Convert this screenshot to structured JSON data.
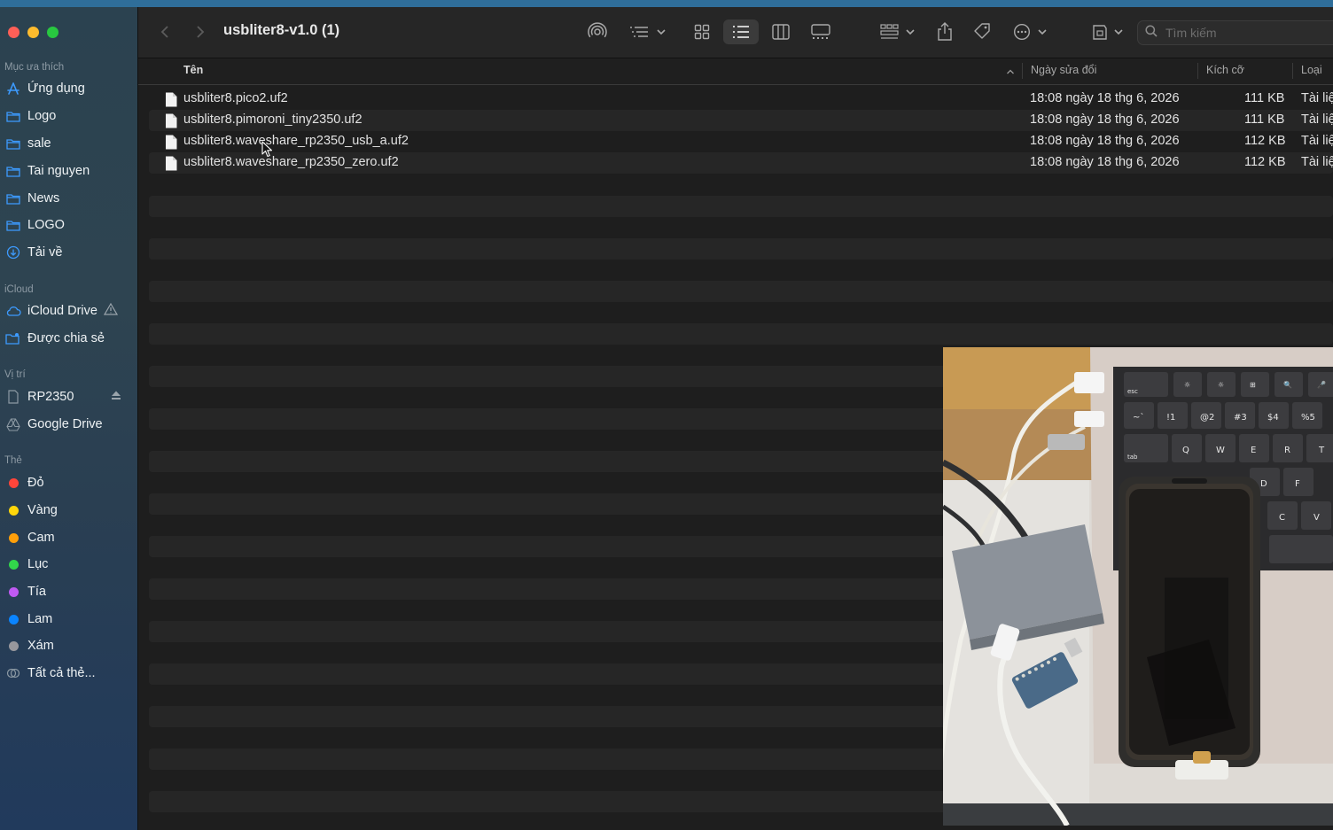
{
  "window": {
    "title": "usbliter8-v1.0 (1)"
  },
  "search": {
    "placeholder": "Tìm kiếm"
  },
  "sidebar": {
    "favorites": {
      "heading": "Mục ưa thích",
      "items": [
        {
          "label": "Ứng dụng",
          "icon": "apps-icon"
        },
        {
          "label": "Logo",
          "icon": "folder-icon"
        },
        {
          "label": "sale",
          "icon": "folder-icon"
        },
        {
          "label": "Tai nguyen",
          "icon": "folder-icon"
        },
        {
          "label": "News",
          "icon": "folder-icon"
        },
        {
          "label": "LOGO",
          "icon": "folder-icon"
        },
        {
          "label": "Tải về",
          "icon": "download-icon"
        }
      ]
    },
    "icloud": {
      "heading": "iCloud",
      "items": [
        {
          "label": "iCloud Drive",
          "icon": "cloud-icon"
        },
        {
          "label": "Được chia sẻ",
          "icon": "shared-folder-icon"
        }
      ]
    },
    "locations": {
      "heading": "Vị trí",
      "items": [
        {
          "label": "RP2350",
          "icon": "drive-icon"
        },
        {
          "label": "Google Drive",
          "icon": "google-drive-icon"
        }
      ]
    },
    "tags": {
      "heading": "Thẻ",
      "items": [
        {
          "label": "Đỏ",
          "color": "#ff453a"
        },
        {
          "label": "Vàng",
          "color": "#ffd60a"
        },
        {
          "label": "Cam",
          "color": "#ff9f0a"
        },
        {
          "label": "Lục",
          "color": "#32d74b"
        },
        {
          "label": "Tía",
          "color": "#bf5af2"
        },
        {
          "label": "Lam",
          "color": "#0a84ff"
        },
        {
          "label": "Xám",
          "color": "#98989d"
        },
        {
          "label": "Tất cả thẻ...",
          "color": ""
        }
      ]
    }
  },
  "columns": {
    "name": "Tên",
    "date": "Ngày sửa đổi",
    "size": "Kích cỡ",
    "kind": "Loại"
  },
  "files": [
    {
      "name": "usbliter8.pico2.uf2",
      "date": "18:08 ngày 18 thg 6, 2026",
      "size": "111 KB",
      "kind": "Tài liệ"
    },
    {
      "name": "usbliter8.pimoroni_tiny2350.uf2",
      "date": "18:08 ngày 18 thg 6, 2026",
      "size": "111 KB",
      "kind": "Tài liệ"
    },
    {
      "name": "usbliter8.waveshare_rp2350_usb_a.uf2",
      "date": "18:08 ngày 18 thg 6, 2026",
      "size": "112 KB",
      "kind": "Tài liệ"
    },
    {
      "name": "usbliter8.waveshare_rp2350_zero.uf2",
      "date": "18:08 ngày 18 thg 6, 2026",
      "size": "112 KB",
      "kind": "Tài liệ"
    }
  ],
  "keyboard": {
    "row1": [
      "esc",
      "☼",
      "☼",
      "⊞",
      "🔍",
      "🎤"
    ],
    "row2": [
      "~`",
      "!1",
      "@2",
      "#3",
      "$4",
      "%5"
    ],
    "row3": [
      "tab",
      "Q",
      "W",
      "E",
      "R",
      "T"
    ],
    "row4": [
      "D",
      "F"
    ],
    "row5": [
      "C",
      "V"
    ]
  }
}
